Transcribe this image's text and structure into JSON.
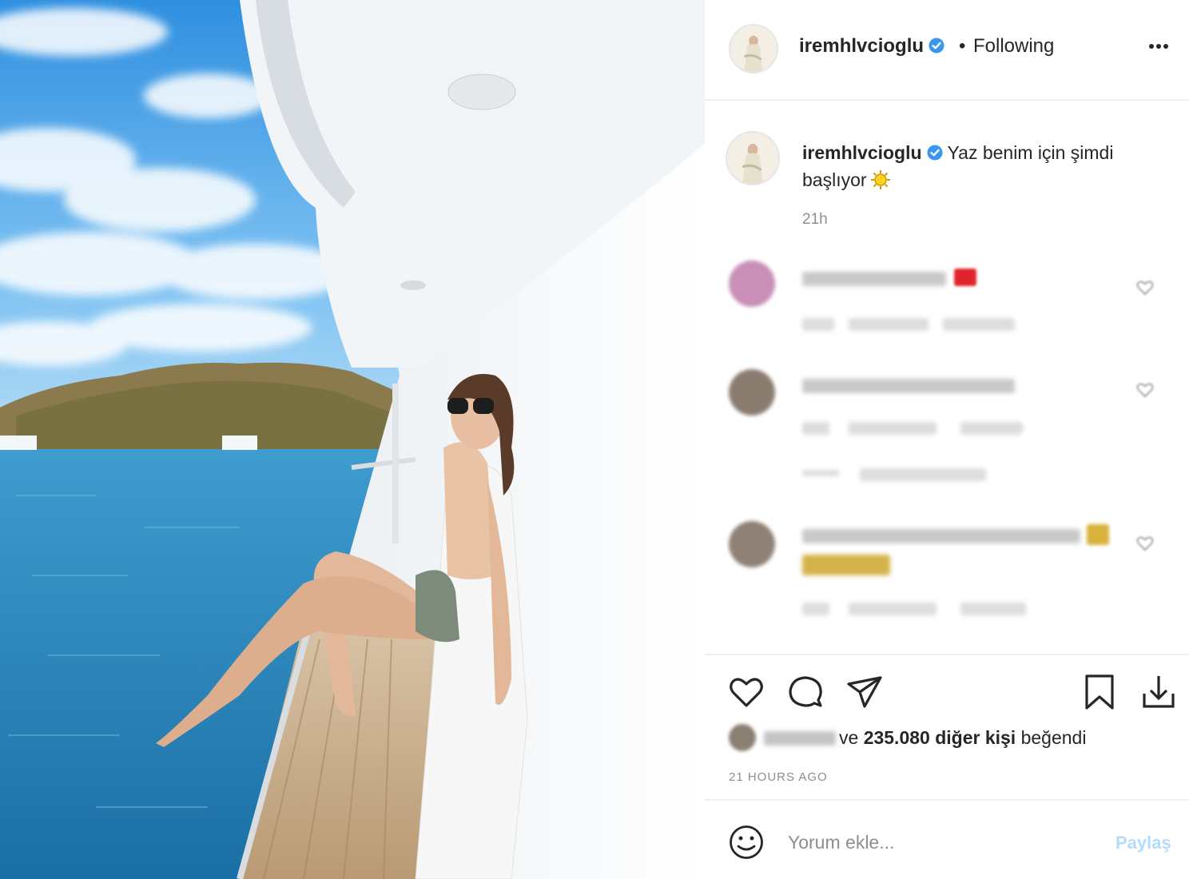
{
  "post": {
    "username": "iremhlvcioglu",
    "follow_separator": "•",
    "follow_status": "Following",
    "caption_text": "Yaz benim için şimdi başlıyor",
    "caption_time": "21h",
    "likes_prefix": "ve",
    "likes_count_text": "235.080 diğer kişi",
    "likes_suffix": "beğendi",
    "posted_time": "21 HOURS AGO"
  },
  "comment_box": {
    "placeholder": "Yorum ekle...",
    "post_label": "Paylaş"
  },
  "icons": {
    "verified": "verified-badge-icon",
    "more": "more-options-icon",
    "like": "heart-icon",
    "comment": "comment-icon",
    "share": "share-icon",
    "save": "bookmark-icon",
    "download": "download-icon",
    "emoji": "emoji-icon",
    "caption_emoji": "sun-emoji"
  },
  "colors": {
    "verified_blue": "#3897f0",
    "text": "#262626",
    "muted": "#8e8e8e",
    "post_button": "#b3dbff",
    "divider": "#efefef"
  }
}
